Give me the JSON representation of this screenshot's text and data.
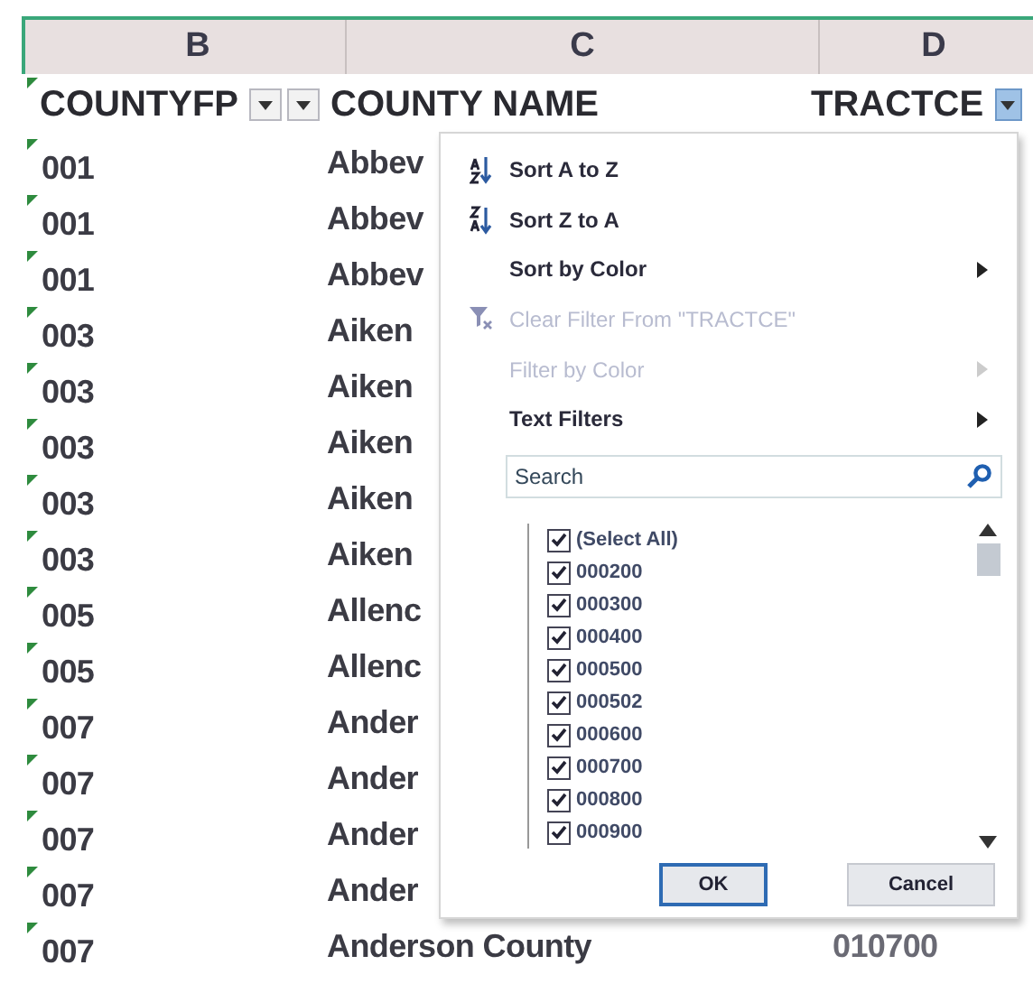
{
  "column_letters": [
    "B",
    "C",
    "D"
  ],
  "headers": [
    {
      "label": "COUNTYFP",
      "filter_open": false
    },
    {
      "label": "COUNTY NAME",
      "filter_open": false
    },
    {
      "label": "TRACTCE",
      "filter_open": true
    }
  ],
  "rows": [
    {
      "countyfp": "001",
      "county_name": "Abbev"
    },
    {
      "countyfp": "001",
      "county_name": "Abbev"
    },
    {
      "countyfp": "001",
      "county_name": "Abbev"
    },
    {
      "countyfp": "003",
      "county_name": "Aiken"
    },
    {
      "countyfp": "003",
      "county_name": "Aiken"
    },
    {
      "countyfp": "003",
      "county_name": "Aiken"
    },
    {
      "countyfp": "003",
      "county_name": "Aiken"
    },
    {
      "countyfp": "003",
      "county_name": "Aiken"
    },
    {
      "countyfp": "005",
      "county_name": "Allenc"
    },
    {
      "countyfp": "005",
      "county_name": "Allenc"
    },
    {
      "countyfp": "007",
      "county_name": "Ander"
    },
    {
      "countyfp": "007",
      "county_name": "Ander"
    },
    {
      "countyfp": "007",
      "county_name": "Ander"
    },
    {
      "countyfp": "007",
      "county_name": "Ander"
    },
    {
      "countyfp": "007",
      "county_name": "Anderson County",
      "tractce": "010700"
    }
  ],
  "filter_menu": {
    "items": [
      {
        "kind": "sort_asc",
        "label": "Sort A to Z",
        "disabled": false,
        "submenu": false
      },
      {
        "kind": "sort_desc",
        "label": "Sort Z to A",
        "disabled": false,
        "submenu": false
      },
      {
        "kind": "plain",
        "label": "Sort by Color",
        "disabled": false,
        "submenu": true
      },
      {
        "kind": "clear",
        "label": "Clear Filter From \"TRACTCE\"",
        "disabled": true,
        "submenu": false
      },
      {
        "kind": "plain",
        "label": "Filter by Color",
        "disabled": true,
        "submenu": true
      },
      {
        "kind": "plain",
        "label": "Text Filters",
        "disabled": false,
        "submenu": true
      }
    ],
    "search": {
      "placeholder": "Search"
    },
    "values": [
      {
        "label": "(Select All)",
        "checked": true
      },
      {
        "label": "000200",
        "checked": true
      },
      {
        "label": "000300",
        "checked": true
      },
      {
        "label": "000400",
        "checked": true
      },
      {
        "label": "000500",
        "checked": true
      },
      {
        "label": "000502",
        "checked": true
      },
      {
        "label": "000600",
        "checked": true
      },
      {
        "label": "000700",
        "checked": true
      },
      {
        "label": "000800",
        "checked": true
      },
      {
        "label": "000900",
        "checked": true
      }
    ],
    "buttons": [
      "OK",
      "Cancel"
    ]
  }
}
